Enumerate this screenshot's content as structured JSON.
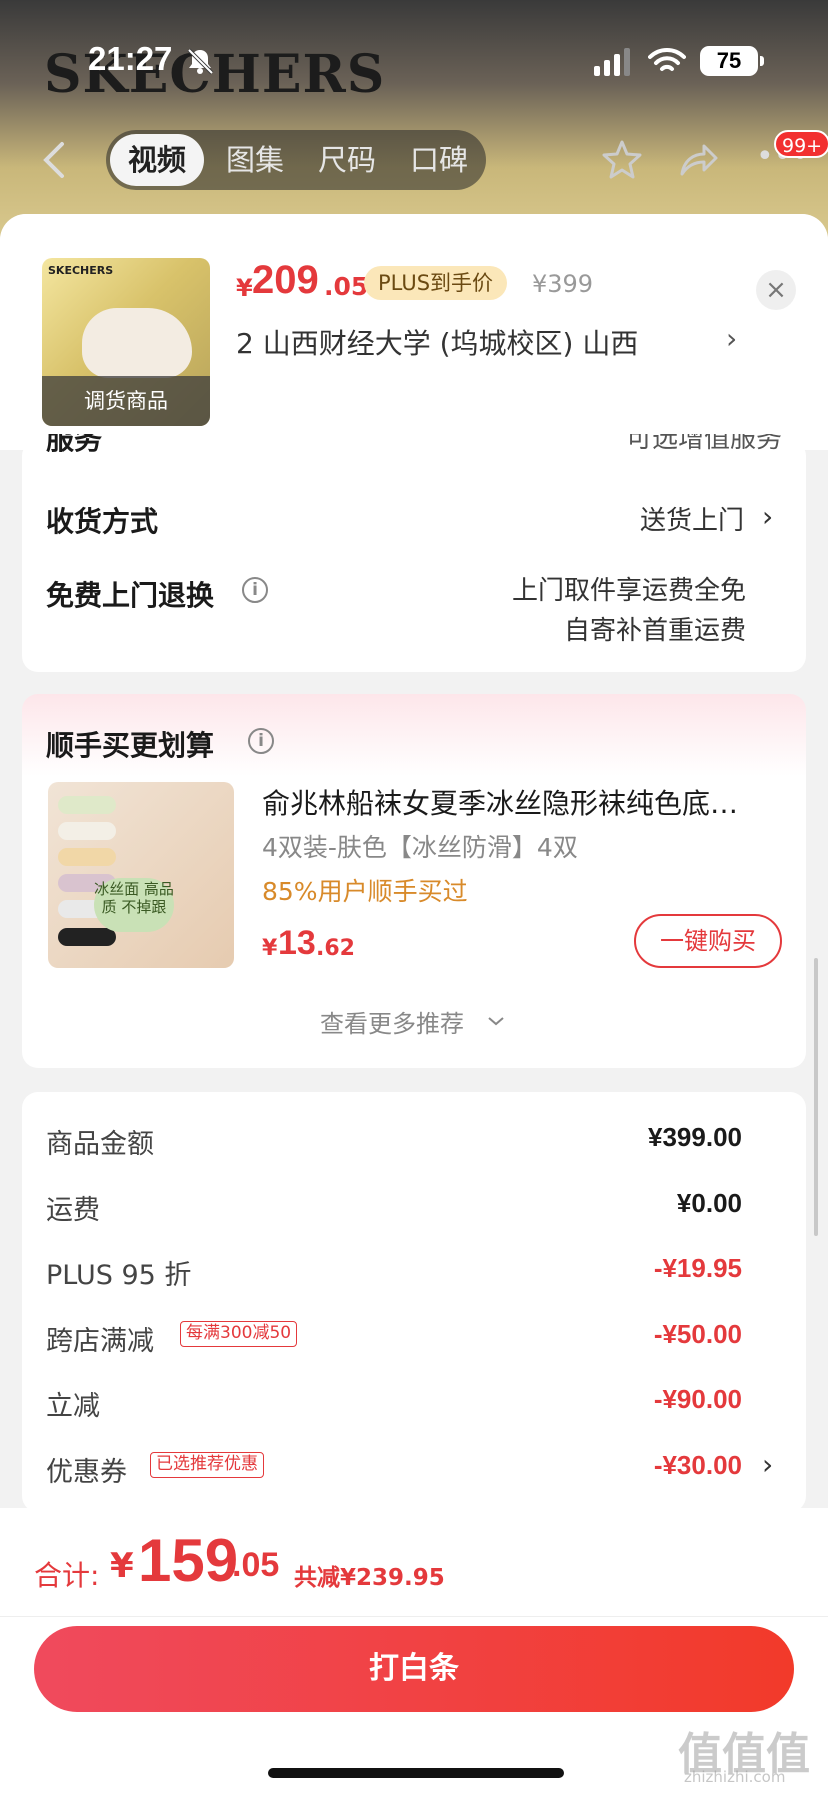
{
  "status_bar": {
    "time": "21:27",
    "battery": "75"
  },
  "header": {
    "brand": "SKECHERS",
    "tabs": [
      "视频",
      "图集",
      "尺码",
      "口碑"
    ],
    "active_tab": 0,
    "badge": "99+"
  },
  "product": {
    "thumb_brand": "SKECHERS",
    "thumb_tag": "调货商品",
    "currency": "¥",
    "price_int": "209",
    "price_dec": ".05",
    "plus_label": "PLUS到手价",
    "original_price": "¥399",
    "address": "2  山西财经大学 (坞城校区) 山西",
    "close_glyph": "×"
  },
  "delivery": {
    "service_label": "服务",
    "service_value": "可选增值服务",
    "method_label": "收货方式",
    "method_value": "送货上门",
    "return_label": "免费上门退换",
    "return_value_1": "上门取件享运费全免",
    "return_value_2": "自寄补首重运费"
  },
  "bundle": {
    "title": "顺手买更划算",
    "image_pill": "冰丝面 高品质 不掉跟",
    "product_title": "俞兆林船袜女夏季冰丝隐形袜纯色底…",
    "spec": "4双装-肤色【冰丝防滑】4双",
    "social": "85%用户顺手买过",
    "currency": "¥",
    "price_int": "13",
    "price_dec": ".62",
    "buy_label": "一键购买",
    "more_label": "查看更多推荐"
  },
  "summary": {
    "lines": [
      {
        "label": "商品金额",
        "value": "¥399.00",
        "tag": "",
        "red": false
      },
      {
        "label": "运费",
        "value": "¥0.00",
        "tag": "",
        "red": false
      },
      {
        "label": "PLUS 95 折",
        "value": "-¥19.95",
        "tag": "",
        "red": true
      },
      {
        "label": "跨店满减",
        "value": "-¥50.00",
        "tag": "每满300减50",
        "red": true
      },
      {
        "label": "立减",
        "value": "-¥90.00",
        "tag": "",
        "red": true
      },
      {
        "label": "优惠券",
        "value": "-¥30.00",
        "tag": "已选推荐优惠",
        "red": true
      }
    ]
  },
  "footer": {
    "total_label": "合计:",
    "currency": "¥",
    "total_int": "159",
    "total_dec": ".05",
    "saved": "共减¥239.95",
    "pay_label": "打白条"
  },
  "watermark": {
    "mark": "值值值",
    "url": "zhizhizhi.com"
  },
  "colors": {
    "accent": "#e4393c",
    "plus_bg": "#fbe7b9",
    "button_gradient_start": "#f04a5d",
    "button_gradient_end": "#f23a2a"
  }
}
